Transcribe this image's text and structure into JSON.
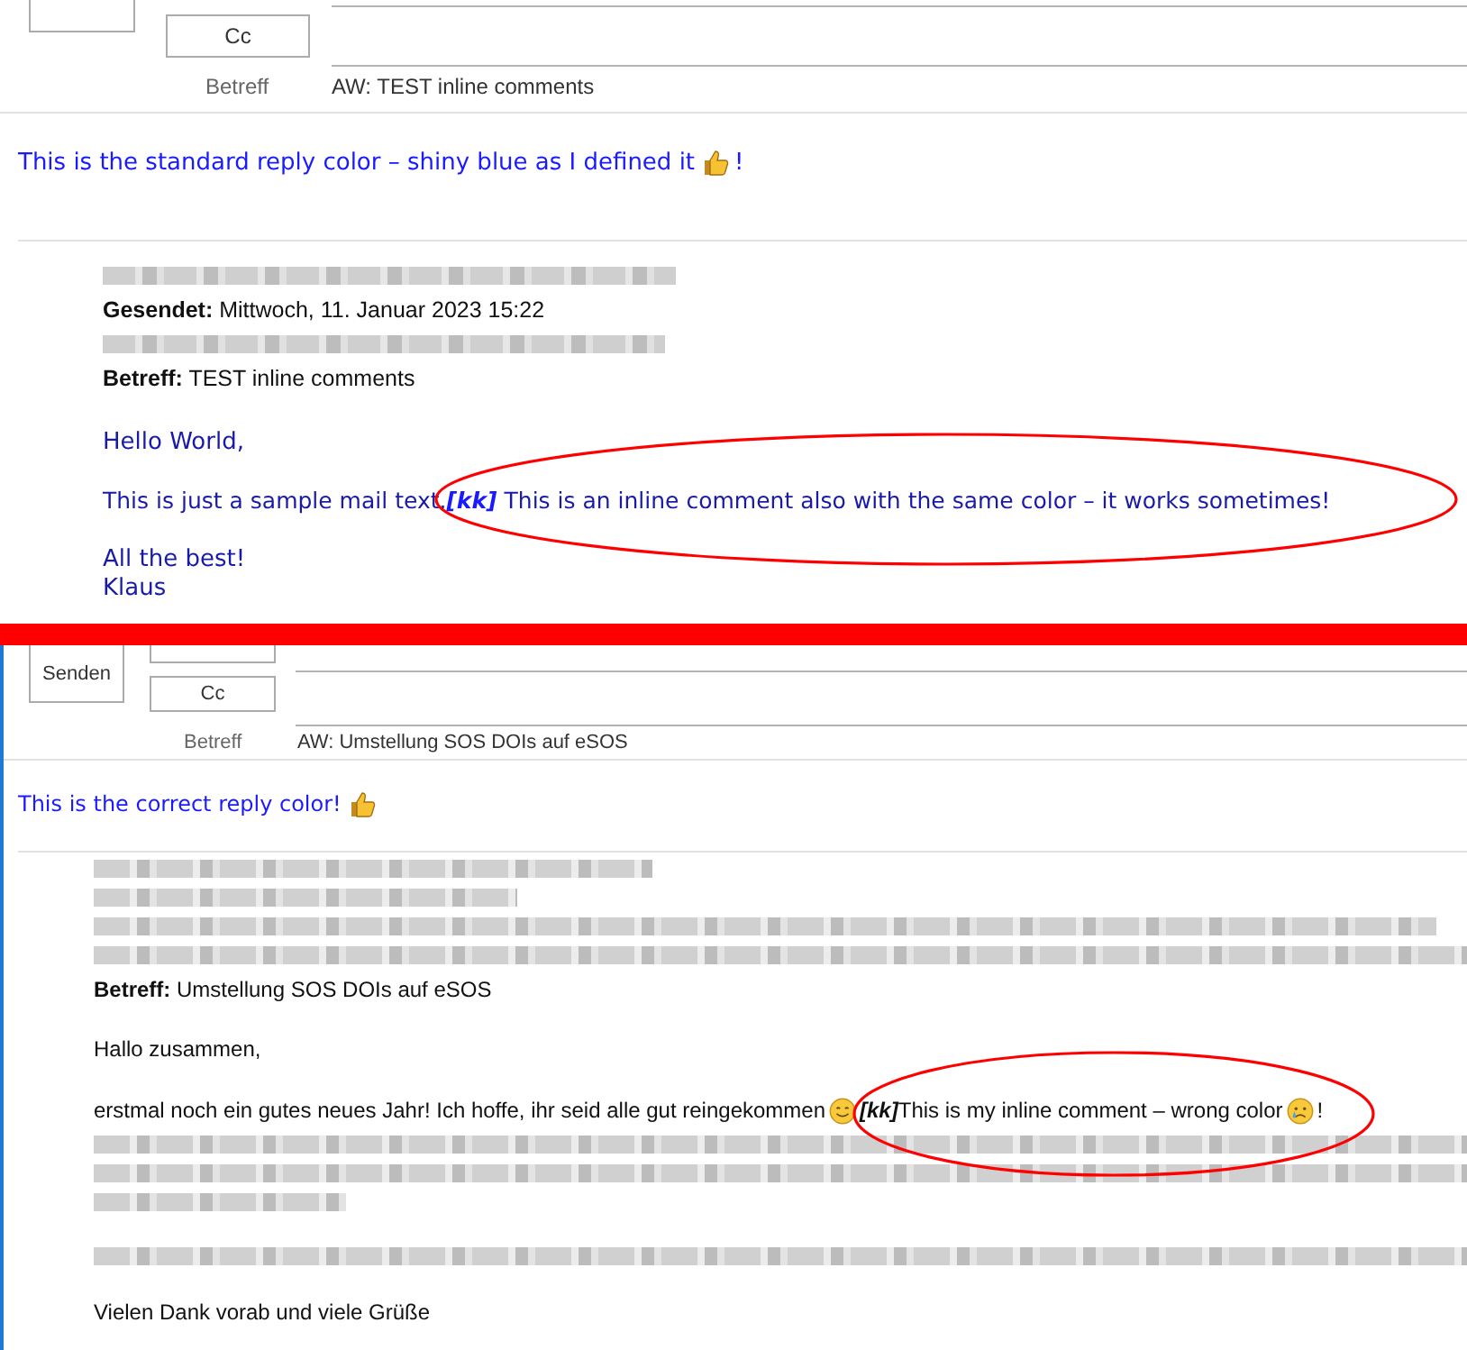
{
  "top_message": {
    "cc_button": "Cc",
    "subject_label": "Betreff",
    "subject": "AW: TEST inline comments",
    "reply_text": "This is the standard reply color – shiny blue as I defined it",
    "reply_end": "!",
    "quoted_sent": "**Gesendet:** Mittwoch, 11. Januar 2023 15:22",
    "quoted_subject": "**Betreff:** TEST inline comments",
    "greeting": "Hello World,",
    "comment_line": "This is just a sample mail text.**[kk]** This is an inline comment also with the same color – it works sometimes!",
    "closing": "All the best!",
    "signature": "Klaus"
  },
  "bottom_message": {
    "send_button": "Senden",
    "cc_button": "Cc",
    "subject_label": "Betreff",
    "subject": "AW: Umstellung SOS DOIs auf eSOS",
    "reply_text": "This is the correct reply color!",
    "quoted_subject": "**Betreff:** Umstellung SOS DOIs auf eSOS",
    "greeting": "Hallo zusammen,",
    "line_text": "erstmal noch ein gutes neues Jahr! Ich hoffe, ihr seid alle gut reingekommen",
    "comment": "**[kk]**This is my inline comment – wrong color",
    "comment_end": "!",
    "closing": "Vielen Dank vorab und viele Grüße"
  }
}
